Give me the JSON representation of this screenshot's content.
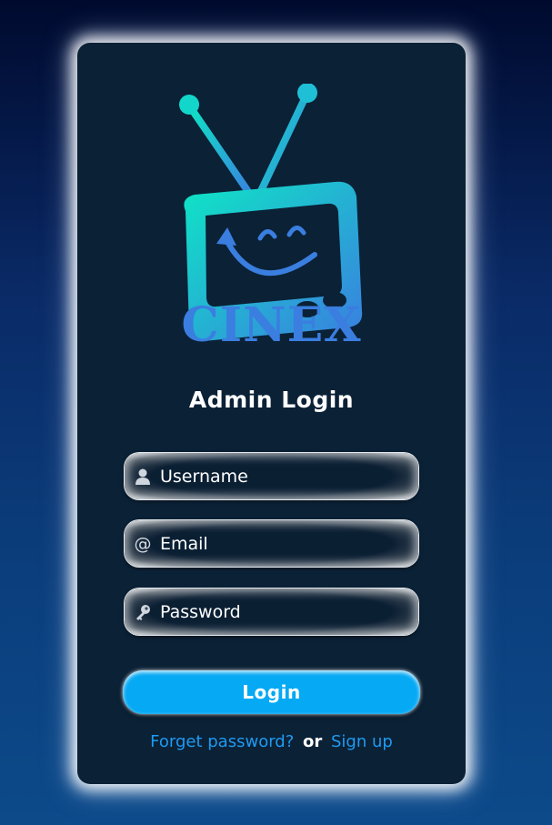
{
  "colors": {
    "card_background": "#0b2136",
    "accent": "#05a9f4",
    "link": "#1e9bf2",
    "logo_gradient_start": "#0ee6c5",
    "logo_gradient_end": "#3a7ee0"
  },
  "logo": {
    "brand": "CINEX",
    "icon": "tv-smile-logo"
  },
  "form": {
    "title": "Admin Login",
    "username": {
      "placeholder": "Username",
      "value": "",
      "icon": "user-icon"
    },
    "email": {
      "placeholder": "Email",
      "value": "",
      "icon": "at-icon"
    },
    "password": {
      "placeholder": "Password",
      "value": "",
      "icon": "key-icon"
    },
    "login_label": "Login"
  },
  "footer": {
    "forgot_label": "Forget password?",
    "or_label": "or",
    "signup_label": "Sign up"
  }
}
